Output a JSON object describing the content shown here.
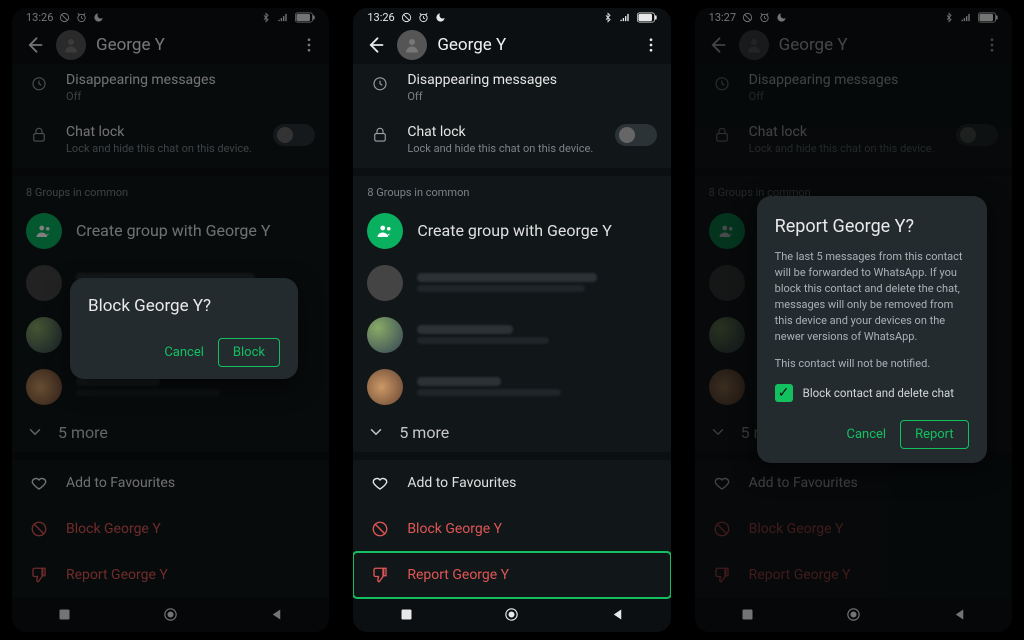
{
  "contact_name": "George Y",
  "statusbar": {
    "time1": "13:26",
    "time2": "13:26",
    "time3": "13:27"
  },
  "settings": {
    "disappearing": {
      "title": "Disappearing messages",
      "sub": "Off"
    },
    "chatlock": {
      "title": "Chat lock",
      "sub": "Lock and hide this chat on this device."
    }
  },
  "groups": {
    "header": "8 Groups in common",
    "create": "Create group with George Y",
    "more": "5 more"
  },
  "actions": {
    "fav": "Add to Favourites",
    "block": "Block George Y",
    "report": "Report George Y"
  },
  "block_dialog": {
    "title": "Block George Y?",
    "cancel": "Cancel",
    "confirm": "Block"
  },
  "report_dialog": {
    "title": "Report George Y?",
    "body": "The last 5 messages from this contact will be forwarded to WhatsApp. If you block this contact and delete the chat, messages will only be removed from this device and your devices on the newer versions of WhatsApp.",
    "body2": "This contact will not be notified.",
    "checkbox": "Block contact and delete chat",
    "cancel": "Cancel",
    "confirm": "Report"
  }
}
